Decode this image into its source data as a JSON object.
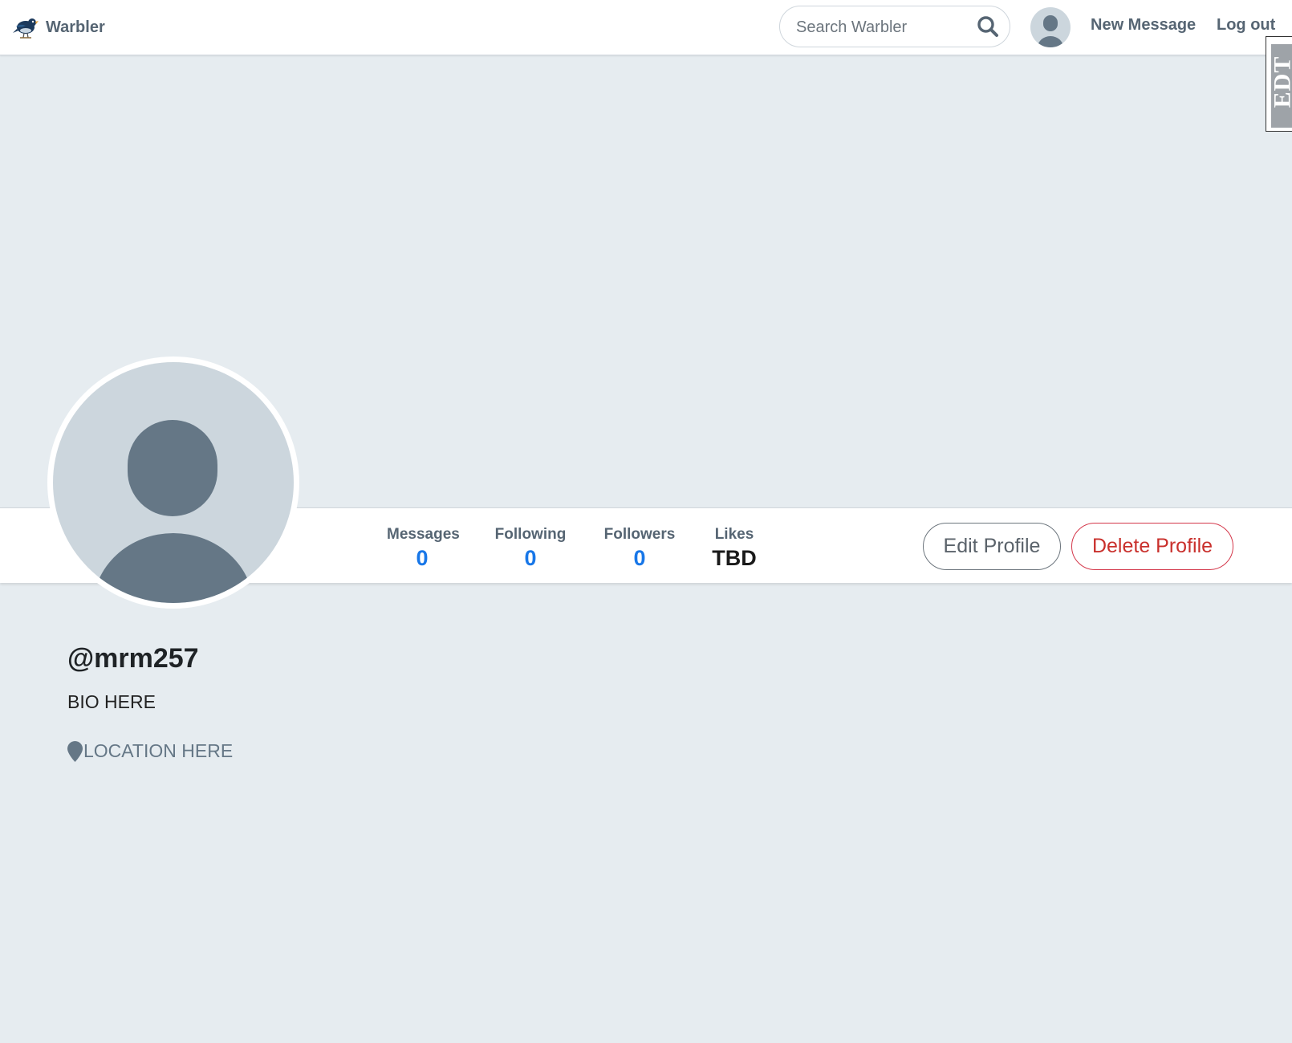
{
  "navbar": {
    "brand": "Warbler",
    "search": {
      "placeholder": "Search Warbler",
      "value": ""
    },
    "links": {
      "new_message": "New Message",
      "logout": "Log out"
    }
  },
  "side_tab": {
    "text": "EDT"
  },
  "profile": {
    "username": "@mrm257",
    "bio": "BIO HERE",
    "location": "LOCATION HERE",
    "stats": {
      "messages": {
        "label": "Messages",
        "value": "0"
      },
      "following": {
        "label": "Following",
        "value": "0"
      },
      "followers": {
        "label": "Followers",
        "value": "0"
      },
      "likes": {
        "label": "Likes",
        "value": "TBD"
      }
    },
    "actions": {
      "edit": "Edit Profile",
      "delete": "Delete Profile"
    }
  },
  "colors": {
    "page_background": "#e6ecf0",
    "stat_value_blue": "#1877e8",
    "muted_text": "#566573",
    "danger": "#c9302c",
    "avatar_bg": "#ccd6dd",
    "avatar_silhouette": "#657786"
  },
  "icons": {
    "brand": "warbler-bird-icon",
    "search": "search-icon",
    "avatar": "default-user-avatar-icon",
    "location": "map-marker-icon"
  }
}
